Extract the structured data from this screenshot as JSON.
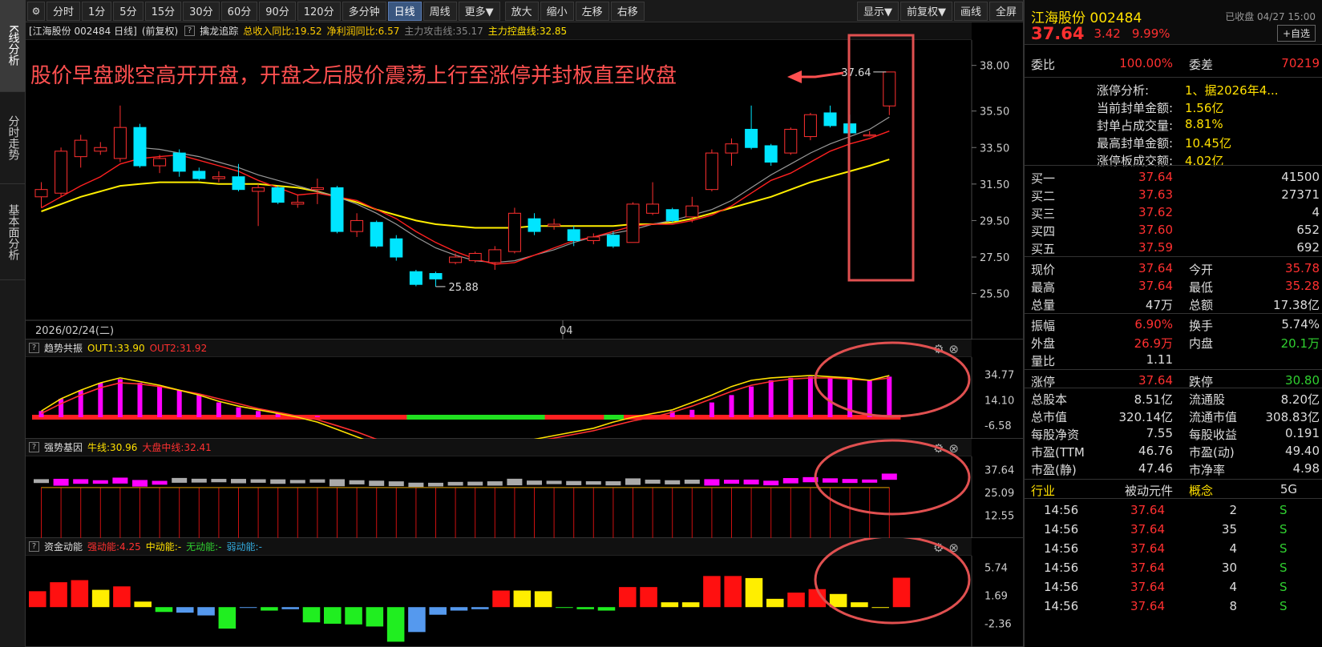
{
  "sidebar": {
    "tabs": [
      {
        "label": "K线分析",
        "active": true
      },
      {
        "label": "分时走势",
        "active": false
      },
      {
        "label": "基本面分析",
        "active": false
      }
    ]
  },
  "toolbar": {
    "gear_icon": "gear-icon",
    "periods": [
      "分时",
      "1分",
      "5分",
      "15分",
      "30分",
      "60分",
      "90分",
      "120分",
      "多分钟",
      "日线",
      "周线",
      "更多▼"
    ],
    "active_period": "日线",
    "actions": [
      "放大",
      "缩小",
      "左移",
      "右移"
    ],
    "right": [
      "显示▼",
      "前复权▼",
      "画线",
      "全屏"
    ]
  },
  "main_panel": {
    "title": "[江海股份 002484 日线]",
    "adjust": "(前复权)",
    "indicator_name": "擒龙追踪",
    "values": [
      {
        "label": "总收入同比:19.52",
        "color": "#ffcc00"
      },
      {
        "label": "净利润同比:6.57",
        "color": "#ffcc00"
      },
      {
        "label": "主力攻击线:35.17",
        "color": "#888888"
      },
      {
        "label": "主力控盘线:32.85",
        "color": "#ffe000"
      }
    ],
    "annotation": "股价早盘跳空高开开盘，开盘之后股价震荡上行至涨停并封板直至收盘",
    "y_ticks": [
      "38.00",
      "35.50",
      "33.50",
      "31.50",
      "29.50",
      "27.50",
      "25.50"
    ],
    "date_label": "2026/02/24(二)",
    "month_label": "04",
    "high_label": "37.64",
    "low_label": "25.88"
  },
  "chart_data": {
    "type": "candlestick",
    "ylim": [
      25.0,
      38.6
    ],
    "candles": [
      {
        "o": 30.8,
        "c": 31.2,
        "h": 31.6,
        "l": 30.2
      },
      {
        "o": 31.0,
        "c": 33.3,
        "h": 33.5,
        "l": 30.8
      },
      {
        "o": 33.0,
        "c": 33.9,
        "h": 34.2,
        "l": 32.4
      },
      {
        "o": 33.3,
        "c": 33.5,
        "h": 33.8,
        "l": 33.1
      },
      {
        "o": 32.9,
        "c": 34.6,
        "h": 35.8,
        "l": 32.7
      },
      {
        "o": 34.6,
        "c": 32.5,
        "h": 34.8,
        "l": 32.4
      },
      {
        "o": 32.5,
        "c": 32.9,
        "h": 33.1,
        "l": 32.1
      },
      {
        "o": 33.2,
        "c": 32.2,
        "h": 33.4,
        "l": 31.9
      },
      {
        "o": 32.2,
        "c": 31.8,
        "h": 32.4,
        "l": 31.7
      },
      {
        "o": 31.8,
        "c": 31.9,
        "h": 32.2,
        "l": 31.6
      },
      {
        "o": 31.9,
        "c": 31.2,
        "h": 32.6,
        "l": 31.1
      },
      {
        "o": 31.1,
        "c": 31.3,
        "h": 31.5,
        "l": 29.2
      },
      {
        "o": 31.3,
        "c": 30.5,
        "h": 31.4,
        "l": 30.4
      },
      {
        "o": 30.4,
        "c": 30.5,
        "h": 30.9,
        "l": 30.2
      },
      {
        "o": 31.2,
        "c": 31.3,
        "h": 31.8,
        "l": 30.4
      },
      {
        "o": 31.3,
        "c": 28.9,
        "h": 31.4,
        "l": 28.8
      },
      {
        "o": 28.9,
        "c": 29.5,
        "h": 29.9,
        "l": 28.6
      },
      {
        "o": 29.4,
        "c": 28.1,
        "h": 29.5,
        "l": 28.0
      },
      {
        "o": 28.5,
        "c": 27.5,
        "h": 28.7,
        "l": 27.3
      },
      {
        "o": 26.7,
        "c": 26.0,
        "h": 26.8,
        "l": 25.9
      },
      {
        "o": 26.6,
        "c": 26.3,
        "h": 26.7,
        "l": 25.88
      },
      {
        "o": 27.2,
        "c": 27.5,
        "h": 27.7,
        "l": 27.1
      },
      {
        "o": 27.3,
        "c": 27.7,
        "h": 27.8,
        "l": 27.2
      },
      {
        "o": 27.2,
        "c": 27.9,
        "h": 28.1,
        "l": 26.8
      },
      {
        "o": 27.8,
        "c": 29.9,
        "h": 30.2,
        "l": 27.7
      },
      {
        "o": 29.6,
        "c": 28.9,
        "h": 29.9,
        "l": 28.7
      },
      {
        "o": 29.2,
        "c": 29.3,
        "h": 29.6,
        "l": 29.0
      },
      {
        "o": 29.0,
        "c": 28.4,
        "h": 29.2,
        "l": 28.1
      },
      {
        "o": 28.4,
        "c": 28.6,
        "h": 28.8,
        "l": 28.2
      },
      {
        "o": 28.7,
        "c": 28.1,
        "h": 28.9,
        "l": 28.0
      },
      {
        "o": 28.3,
        "c": 30.4,
        "h": 30.5,
        "l": 28.3
      },
      {
        "o": 29.9,
        "c": 30.4,
        "h": 31.6,
        "l": 29.8
      },
      {
        "o": 30.1,
        "c": 29.5,
        "h": 30.2,
        "l": 29.4
      },
      {
        "o": 29.7,
        "c": 30.3,
        "h": 30.8,
        "l": 29.4
      },
      {
        "o": 31.2,
        "c": 33.2,
        "h": 33.4,
        "l": 31.1
      },
      {
        "o": 33.2,
        "c": 33.7,
        "h": 34.0,
        "l": 32.5
      },
      {
        "o": 34.5,
        "c": 33.5,
        "h": 35.8,
        "l": 33.4
      },
      {
        "o": 33.6,
        "c": 32.7,
        "h": 33.7,
        "l": 32.5
      },
      {
        "o": 33.2,
        "c": 34.5,
        "h": 34.6,
        "l": 33.1
      },
      {
        "o": 34.1,
        "c": 35.3,
        "h": 35.4,
        "l": 33.9
      },
      {
        "o": 35.4,
        "c": 34.7,
        "h": 35.8,
        "l": 34.6
      },
      {
        "o": 34.8,
        "c": 34.3,
        "h": 35.3,
        "l": 34.1
      },
      {
        "o": 34.2,
        "c": 34.2,
        "h": 34.4,
        "l": 34.1
      },
      {
        "o": 35.78,
        "c": 37.64,
        "h": 37.64,
        "l": 35.28
      }
    ],
    "ma_red": [
      30.2,
      30.8,
      31.4,
      31.9,
      32.6,
      32.9,
      33.0,
      33.1,
      32.8,
      32.5,
      32.2,
      31.7,
      31.3,
      30.9,
      31.0,
      30.8,
      30.6,
      30.1,
      29.6,
      28.9,
      28.3,
      27.8,
      27.4,
      27.1,
      27.2,
      27.6,
      28.0,
      28.4,
      28.6,
      28.9,
      29.2,
      29.3,
      29.3,
      29.5,
      29.8,
      30.3,
      31.0,
      31.7,
      32.1,
      32.7,
      33.3,
      33.7,
      34.0,
      34.4
    ],
    "ma_gray": [
      null,
      null,
      null,
      null,
      null,
      33.5,
      33.4,
      33.2,
      33.0,
      32.7,
      32.4,
      32.0,
      31.7,
      31.4,
      31.1,
      30.8,
      30.4,
      29.9,
      29.3,
      28.6,
      28.0,
      27.6,
      27.3,
      27.2,
      27.3,
      27.6,
      27.9,
      28.3,
      28.6,
      28.8,
      29.0,
      29.3,
      29.5,
      29.8,
      30.1,
      30.6,
      31.3,
      32.0,
      32.6,
      33.2,
      33.7,
      34.1,
      34.5,
      35.17
    ],
    "ma_yellow": [
      30.0,
      30.4,
      30.8,
      31.1,
      31.4,
      31.5,
      31.6,
      31.6,
      31.6,
      31.5,
      31.5,
      31.5,
      31.4,
      31.3,
      31.1,
      30.8,
      30.5,
      30.1,
      29.8,
      29.5,
      29.3,
      29.2,
      29.1,
      29.1,
      29.1,
      29.2,
      29.2,
      29.2,
      29.2,
      29.2,
      29.3,
      29.3,
      29.4,
      29.6,
      29.9,
      30.2,
      30.5,
      30.8,
      31.2,
      31.6,
      31.9,
      32.2,
      32.5,
      32.85
    ],
    "trend": {
      "title": "趋势共振",
      "out1": "OUT1:33.90",
      "out2": "OUT2:31.92",
      "ticks": [
        "34.77",
        "14.10",
        "-6.58"
      ],
      "ylim": [
        -15,
        45
      ],
      "bars": [
        5,
        15,
        22,
        28,
        31,
        28,
        25,
        22,
        18,
        12,
        8,
        5,
        3,
        1,
        1,
        0,
        0,
        0,
        0,
        0,
        0,
        0,
        0,
        0,
        0,
        0,
        0,
        0,
        0,
        0,
        0,
        0,
        5,
        6,
        12,
        18,
        25,
        30,
        32,
        33,
        33,
        32,
        30,
        33
      ],
      "line1": [
        5,
        15,
        22,
        28,
        32,
        29,
        26,
        22,
        18,
        13,
        9,
        6,
        3,
        0,
        -4,
        -10,
        -16,
        -22,
        -27,
        -30,
        -32,
        -33,
        -31,
        -27,
        -22,
        -18,
        -15,
        -12,
        -9,
        -4,
        0,
        3,
        6,
        12,
        18,
        25,
        30,
        32,
        33,
        34,
        33,
        32,
        30,
        33.9
      ],
      "line2": [
        3,
        11,
        18,
        24,
        28,
        27,
        25,
        22,
        19,
        15,
        11,
        7,
        4,
        1,
        -2,
        -7,
        -12,
        -18,
        -23,
        -27,
        -30,
        -32,
        -31,
        -28,
        -24,
        -20,
        -17,
        -14,
        -11,
        -7,
        -3,
        0,
        4,
        9,
        15,
        21,
        26,
        29,
        31,
        32,
        32,
        31,
        30,
        31.9
      ],
      "band": [
        "r",
        "r",
        "r",
        "r",
        "r",
        "r",
        "r",
        "r",
        "r",
        "r",
        "r",
        "r",
        "r",
        "r",
        "r",
        "r",
        "r",
        "r",
        "r",
        "g",
        "g",
        "g",
        "g",
        "g",
        "g",
        "g",
        "r",
        "r",
        "r",
        "g",
        "r",
        "r",
        "r",
        "r",
        "r",
        "r",
        "r",
        "r",
        "r",
        "r",
        "r",
        "r",
        "r",
        "r"
      ]
    },
    "gene": {
      "title": "强势基因",
      "a": "牛线:30.96",
      "b": "大盘中线:32.41",
      "ticks": [
        "37.64",
        "25.09",
        "12.55"
      ],
      "ylim": [
        0,
        45
      ],
      "close": [
        31.2,
        33.3,
        33.9,
        33.5,
        34.6,
        32.5,
        32.9,
        32.2,
        31.8,
        31.9,
        31.2,
        31.3,
        30.5,
        30.5,
        31.3,
        28.9,
        29.5,
        28.1,
        27.5,
        26.0,
        26.3,
        27.5,
        27.7,
        27.9,
        29.9,
        28.9,
        29.3,
        28.4,
        28.6,
        28.1,
        30.4,
        30.4,
        29.5,
        30.3,
        33.2,
        33.7,
        33.5,
        32.7,
        34.5,
        35.3,
        34.7,
        34.3,
        34.2,
        37.64
      ],
      "open": [
        30.8,
        31.0,
        33.0,
        33.3,
        32.9,
        34.6,
        32.5,
        33.2,
        32.2,
        31.8,
        31.9,
        31.1,
        31.3,
        30.4,
        31.2,
        31.3,
        28.9,
        29.4,
        28.5,
        26.7,
        26.6,
        27.2,
        27.3,
        27.2,
        27.8,
        29.6,
        29.2,
        29.0,
        28.4,
        28.7,
        28.3,
        29.9,
        30.1,
        29.7,
        31.2,
        33.2,
        34.5,
        33.6,
        33.2,
        34.1,
        35.4,
        34.8,
        34.2,
        35.78
      ],
      "mid": 32.41
    },
    "money": {
      "title": "资金动能",
      "s1": "强动能:4.25",
      "s2": "中动能:-",
      "s3": "无动能:-",
      "s4": "弱动能:-",
      "ticks": [
        "5.74",
        "1.69",
        "-2.36"
      ],
      "ylim": [
        -5.3,
        7.2
      ],
      "values": [
        2.3,
        3.6,
        3.9,
        2.5,
        3.0,
        0.8,
        -0.7,
        -0.8,
        -1.2,
        -3.1,
        -0.1,
        -0.5,
        -0.3,
        -2.2,
        -2.4,
        -2.5,
        -2.8,
        -5.0,
        -3.6,
        -1.1,
        -0.5,
        -0.3,
        2.4,
        2.4,
        2.3,
        -0.1,
        -0.3,
        -0.5,
        2.9,
        2.9,
        0.7,
        0.7,
        4.5,
        4.5,
        4.2,
        1.2,
        2.1,
        2.6,
        1.9,
        0.7,
        -0.1,
        4.25
      ],
      "colors": [
        "r",
        "r",
        "r",
        "y",
        "r",
        "y",
        "g",
        "b",
        "b",
        "g",
        "b",
        "g",
        "b",
        "g",
        "g",
        "g",
        "g",
        "g",
        "b",
        "b",
        "b",
        "b",
        "r",
        "y",
        "y",
        "g",
        "g",
        "g",
        "r",
        "r",
        "y",
        "y",
        "r",
        "r",
        "y",
        "y",
        "r",
        "r",
        "y",
        "y",
        "y",
        "r"
      ]
    }
  },
  "quote": {
    "name": "江海股份 002484",
    "status": "已收盘 04/27 15:00",
    "price": "37.64",
    "change": "3.42",
    "pct": "9.99%",
    "watch_btn": "+自选",
    "ratio_label": "委比",
    "ratio": "100.00%",
    "diff_label": "委差",
    "diff": "70219",
    "limit_analysis": [
      {
        "k": "涨停分析:",
        "v": "1、据2026年4..."
      },
      {
        "k": "当前封单金额:",
        "v": "1.56亿"
      },
      {
        "k": "封单占成交量:",
        "v": "8.81%"
      },
      {
        "k": "最高封单金额:",
        "v": "10.45亿"
      },
      {
        "k": "涨停板成交额:",
        "v": "4.02亿"
      }
    ],
    "bids": [
      {
        "k": "买一",
        "p": "37.64",
        "v": "41500"
      },
      {
        "k": "买二",
        "p": "37.63",
        "v": "27371"
      },
      {
        "k": "买三",
        "p": "37.62",
        "v": "4"
      },
      {
        "k": "买四",
        "p": "37.60",
        "v": "652"
      },
      {
        "k": "买五",
        "p": "37.59",
        "v": "692"
      }
    ],
    "stats1": [
      {
        "k1": "现价",
        "v1": "37.64",
        "c1": "red",
        "k2": "今开",
        "v2": "35.78",
        "c2": "red"
      },
      {
        "k1": "最高",
        "v1": "37.64",
        "c1": "red",
        "k2": "最低",
        "v2": "35.28",
        "c2": "red"
      },
      {
        "k1": "总量",
        "v1": "47万",
        "c1": "white",
        "k2": "总额",
        "v2": "17.38亿",
        "c2": "white"
      }
    ],
    "stats2": [
      {
        "k1": "振幅",
        "v1": "6.90%",
        "c1": "red",
        "k2": "换手",
        "v2": "5.74%",
        "c2": "white"
      },
      {
        "k1": "外盘",
        "v1": "26.9万",
        "c1": "red",
        "k2": "内盘",
        "v2": "20.1万",
        "c2": "green"
      },
      {
        "k1": "量比",
        "v1": "1.11",
        "c1": "white",
        "k2": "",
        "v2": "",
        "c2": "white"
      }
    ],
    "limits": {
      "k1": "涨停",
      "v1": "37.64",
      "k2": "跌停",
      "v2": "30.80"
    },
    "stats3": [
      {
        "k1": "总股本",
        "v1": "8.51亿",
        "k2": "流通股",
        "v2": "8.20亿"
      },
      {
        "k1": "总市值",
        "v1": "320.14亿",
        "k2": "流通市值",
        "v2": "308.83亿"
      },
      {
        "k1": "每股净资",
        "v1": "7.55",
        "k2": "每股收益",
        "v2": "0.191"
      },
      {
        "k1": "市盈(TTM",
        "v1": "46.76",
        "k2": "市盈(动)",
        "v2": "49.40"
      },
      {
        "k1": "市盈(静)",
        "v1": "47.46",
        "k2": "市净率",
        "v2": "4.98"
      }
    ],
    "industry": {
      "k1": "行业",
      "v1": "被动元件",
      "k2": "概念",
      "v2": "5G"
    },
    "ticks": [
      {
        "t": "14:56",
        "p": "37.64",
        "v": "2",
        "d": "S"
      },
      {
        "t": "14:56",
        "p": "37.64",
        "v": "35",
        "d": "S"
      },
      {
        "t": "14:56",
        "p": "37.64",
        "v": "4",
        "d": "S"
      },
      {
        "t": "14:56",
        "p": "37.64",
        "v": "30",
        "d": "S"
      },
      {
        "t": "14:56",
        "p": "37.64",
        "v": "4",
        "d": "S"
      },
      {
        "t": "14:56",
        "p": "37.64",
        "v": "8",
        "d": "S"
      }
    ]
  },
  "colors": {
    "up": "#ff3030",
    "down": "#00e5ff",
    "ma_red": "#ff2020",
    "ma_gray": "#999999",
    "ma_yellow": "#ffee00",
    "magenta": "#ff00ff",
    "annotation_border": "#e05050"
  }
}
